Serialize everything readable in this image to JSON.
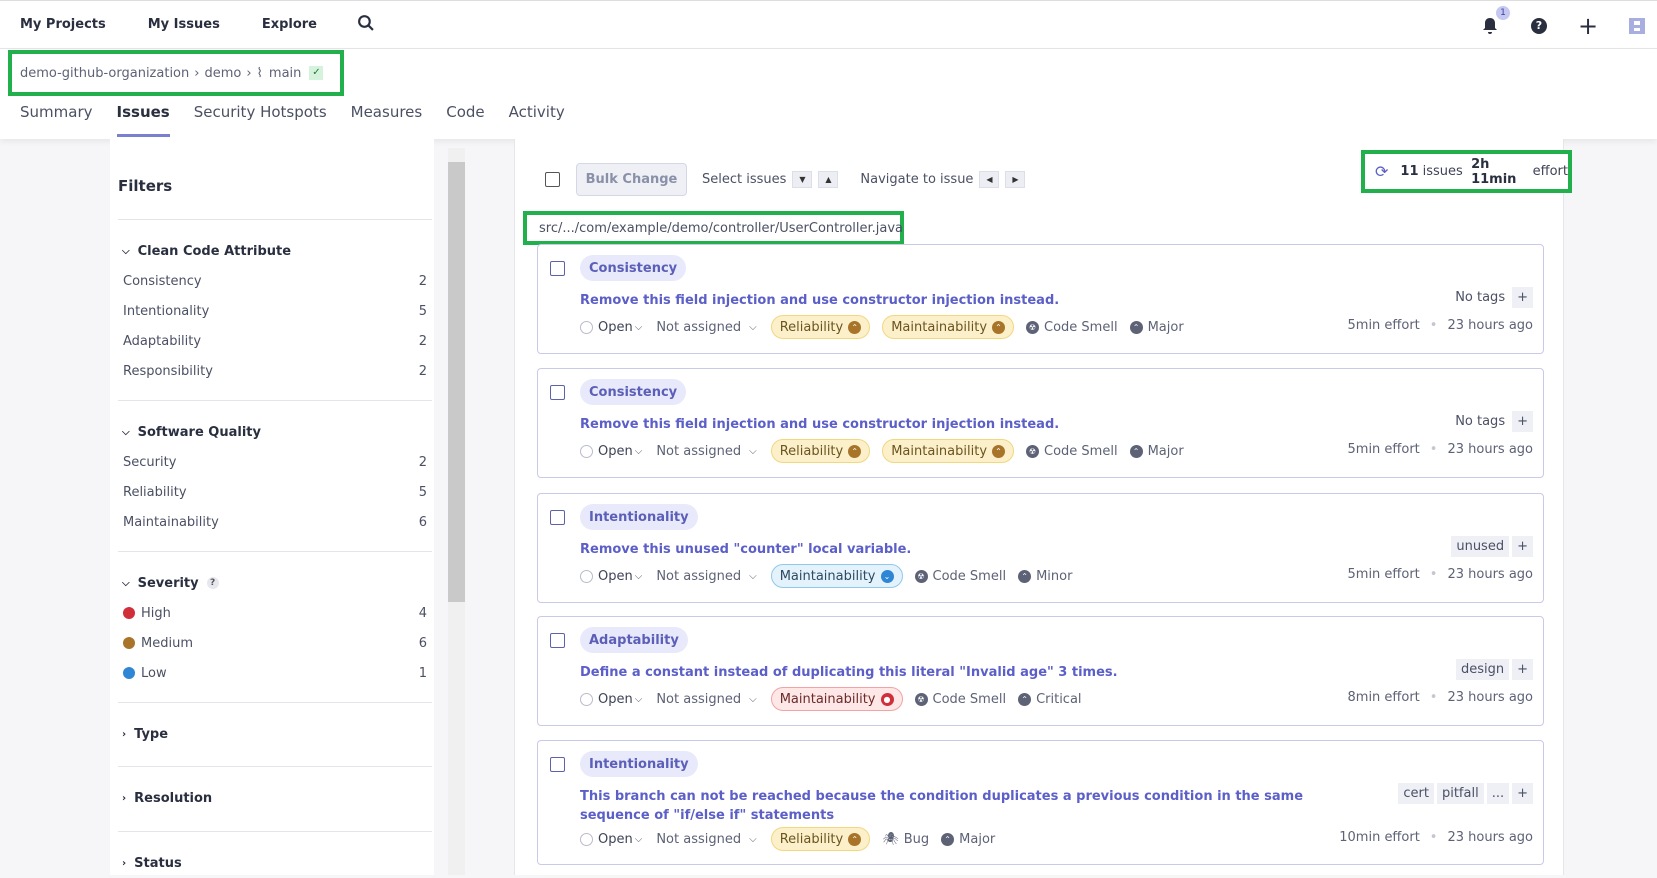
{
  "topnav": {
    "items": [
      "My Projects",
      "My Issues",
      "Explore"
    ],
    "notifications": "1"
  },
  "breadcrumb": {
    "org": "demo-github-organization",
    "project": "demo",
    "branch": "main"
  },
  "tabs": [
    "Summary",
    "Issues",
    "Security Hotspots",
    "Measures",
    "Code",
    "Activity"
  ],
  "filters": {
    "title": "Filters",
    "clean_code": {
      "label": "Clean Code Attribute",
      "items": [
        {
          "label": "Consistency",
          "count": "2"
        },
        {
          "label": "Intentionality",
          "count": "5"
        },
        {
          "label": "Adaptability",
          "count": "2"
        },
        {
          "label": "Responsibility",
          "count": "2"
        }
      ]
    },
    "software_quality": {
      "label": "Software Quality",
      "items": [
        {
          "label": "Security",
          "count": "2"
        },
        {
          "label": "Reliability",
          "count": "5"
        },
        {
          "label": "Maintainability",
          "count": "6"
        }
      ]
    },
    "severity": {
      "label": "Severity",
      "help": "?",
      "items": [
        {
          "label": "High",
          "count": "4",
          "color": "#d02f3a"
        },
        {
          "label": "Medium",
          "count": "6",
          "color": "#a8742a"
        },
        {
          "label": "Low",
          "count": "1",
          "color": "#2f86d4"
        }
      ]
    },
    "collapsed": [
      "Type",
      "Resolution",
      "Status"
    ]
  },
  "toolbar": {
    "bulk_change": "Bulk Change",
    "select_issues": "Select issues",
    "navigate": "Navigate to issue",
    "issues_count": "11",
    "issues_label": "issues",
    "effort_value": "2h 11min",
    "effort_label": "effort"
  },
  "file_path": "src/.../com/example/demo/controller/UserController.java",
  "issues": [
    {
      "attribute": "Consistency",
      "message": "Remove this field injection and use constructor injection instead.",
      "tags": [],
      "no_tags": "No tags",
      "status": "Open",
      "assignee": "Not assigned",
      "qualities": [
        {
          "label": "Reliability",
          "sev": "med"
        },
        {
          "label": "Maintainability",
          "sev": "med"
        }
      ],
      "type": "Code Smell",
      "severity": "Major",
      "effort": "5min effort",
      "age": "23 hours ago"
    },
    {
      "attribute": "Consistency",
      "message": "Remove this field injection and use constructor injection instead.",
      "tags": [],
      "no_tags": "No tags",
      "status": "Open",
      "assignee": "Not assigned",
      "qualities": [
        {
          "label": "Reliability",
          "sev": "med"
        },
        {
          "label": "Maintainability",
          "sev": "med"
        }
      ],
      "type": "Code Smell",
      "severity": "Major",
      "effort": "5min effort",
      "age": "23 hours ago"
    },
    {
      "attribute": "Intentionality",
      "message": "Remove this unused \"counter\" local variable.",
      "tags": [
        "unused"
      ],
      "status": "Open",
      "assignee": "Not assigned",
      "qualities": [
        {
          "label": "Maintainability",
          "sev": "low"
        }
      ],
      "type": "Code Smell",
      "severity": "Minor",
      "effort": "5min effort",
      "age": "23 hours ago"
    },
    {
      "attribute": "Adaptability",
      "message": "Define a constant instead of duplicating this literal \"Invalid age\" 3 times.",
      "tags": [
        "design"
      ],
      "status": "Open",
      "assignee": "Not assigned",
      "qualities": [
        {
          "label": "Maintainability",
          "sev": "high"
        }
      ],
      "type": "Code Smell",
      "severity": "Critical",
      "effort": "8min effort",
      "age": "23 hours ago"
    },
    {
      "attribute": "Intentionality",
      "message": "This branch can not be reached because the condition duplicates a previous condition in the same sequence of \"if/else if\" statements",
      "tags": [
        "cert",
        "pitfall",
        "..."
      ],
      "status": "Open",
      "assignee": "Not assigned",
      "qualities": [
        {
          "label": "Reliability",
          "sev": "med"
        }
      ],
      "type": "Bug",
      "severity": "Major",
      "effort": "10min effort",
      "age": "23 hours ago"
    }
  ]
}
